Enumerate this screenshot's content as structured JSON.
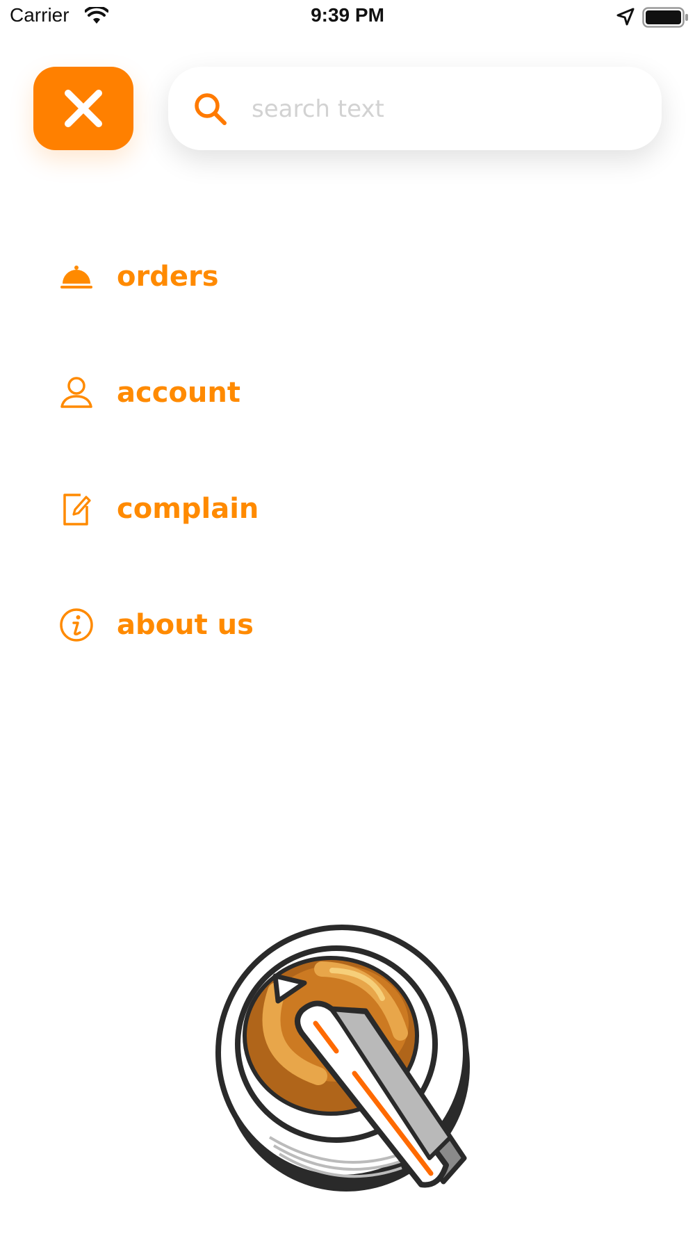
{
  "status_bar": {
    "carrier": "Carrier",
    "time": "9:39 PM",
    "icons": [
      "wifi-icon",
      "location-icon",
      "battery-icon"
    ]
  },
  "header": {
    "close_icon": "close-icon",
    "search": {
      "placeholder": "search text",
      "value": "",
      "icon": "search-icon"
    }
  },
  "menu": {
    "items": [
      {
        "label": "orders",
        "icon": "food-cloche-icon"
      },
      {
        "label": "account",
        "icon": "user-icon"
      },
      {
        "label": "complain",
        "icon": "edit-note-icon"
      },
      {
        "label": "about us",
        "icon": "info-icon"
      }
    ]
  },
  "colors": {
    "accent": "#ff8000",
    "menu_text": "#ff8a00",
    "placeholder": "#d2d2d2",
    "background": "#ffffff"
  }
}
